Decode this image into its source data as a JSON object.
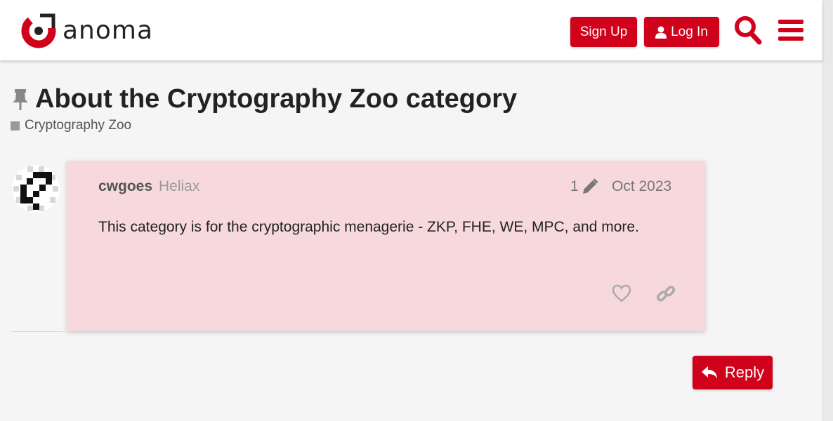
{
  "header": {
    "logo_text": "anoma",
    "signup_label": "Sign Up",
    "login_label": "Log In",
    "login_icon": "user-icon",
    "search_icon": "search-icon",
    "menu_icon": "hamburger-menu-icon"
  },
  "topic": {
    "pin_icon": "thumbtack-icon",
    "title": "About the Cryptography Zoo category",
    "category": "Cryptography Zoo"
  },
  "post": {
    "username": "cwgoes",
    "user_group": "Heliax",
    "edit_count": "1",
    "edit_icon": "pencil-icon",
    "date": "Oct 2023",
    "body": "This category is for the cryptographic menagerie - ZKP, FHE, WE, MPC, and more.",
    "like_icon": "heart-icon",
    "share_icon": "link-icon"
  },
  "reply": {
    "label": "Reply",
    "icon": "reply-icon"
  },
  "colors": {
    "accent": "#d0021b",
    "post_background": "#f7d9dd",
    "page_background": "#f5f5f5"
  }
}
